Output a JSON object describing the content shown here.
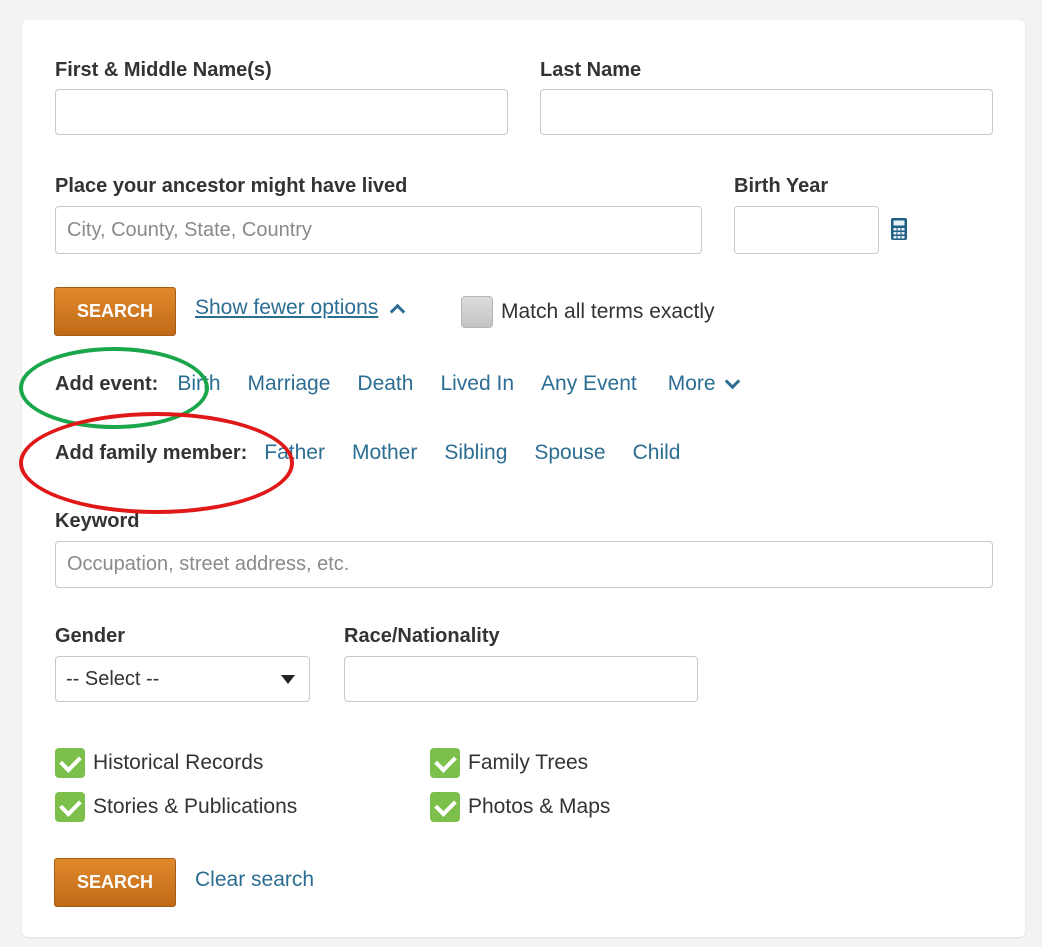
{
  "form": {
    "first_name_label": "First & Middle Name(s)",
    "last_name_label": "Last Name",
    "first_name_value": "",
    "last_name_value": "",
    "place_label": "Place your ancestor might have lived",
    "place_placeholder": "City, County, State, Country",
    "birth_year_label": "Birth Year",
    "birth_year_value": "",
    "search_label": "SEARCH",
    "show_fewer_label": "Show fewer options",
    "match_exact_label": "Match all terms exactly",
    "match_exact_checked": false,
    "add_event_label": "Add event:",
    "events": [
      "Birth",
      "Marriage",
      "Death",
      "Lived In",
      "Any Event"
    ],
    "more_label": "More",
    "add_family_label": "Add family member:",
    "family": [
      "Father",
      "Mother",
      "Sibling",
      "Spouse",
      "Child"
    ],
    "keyword_label": "Keyword",
    "keyword_placeholder": "Occupation, street address, etc.",
    "gender_label": "Gender",
    "gender_selected": "-- Select --",
    "race_label": "Race/Nationality",
    "race_value": "",
    "collections": [
      {
        "label": "Historical Records",
        "checked": true
      },
      {
        "label": "Family Trees",
        "checked": true
      },
      {
        "label": "Stories & Publications",
        "checked": true
      },
      {
        "label": "Photos & Maps",
        "checked": true
      }
    ],
    "search_bottom_label": "SEARCH",
    "clear_label": "Clear search"
  },
  "colors": {
    "button": "#d07a22",
    "link": "#2c6e93",
    "check": "#7cc04b",
    "annotation_green": "#1aa64a",
    "annotation_red": "#e01818"
  },
  "icons": [
    "calculator-icon",
    "chevron-up-icon",
    "chevron-down-icon",
    "checkmark-icon",
    "caret-down-icon"
  ]
}
